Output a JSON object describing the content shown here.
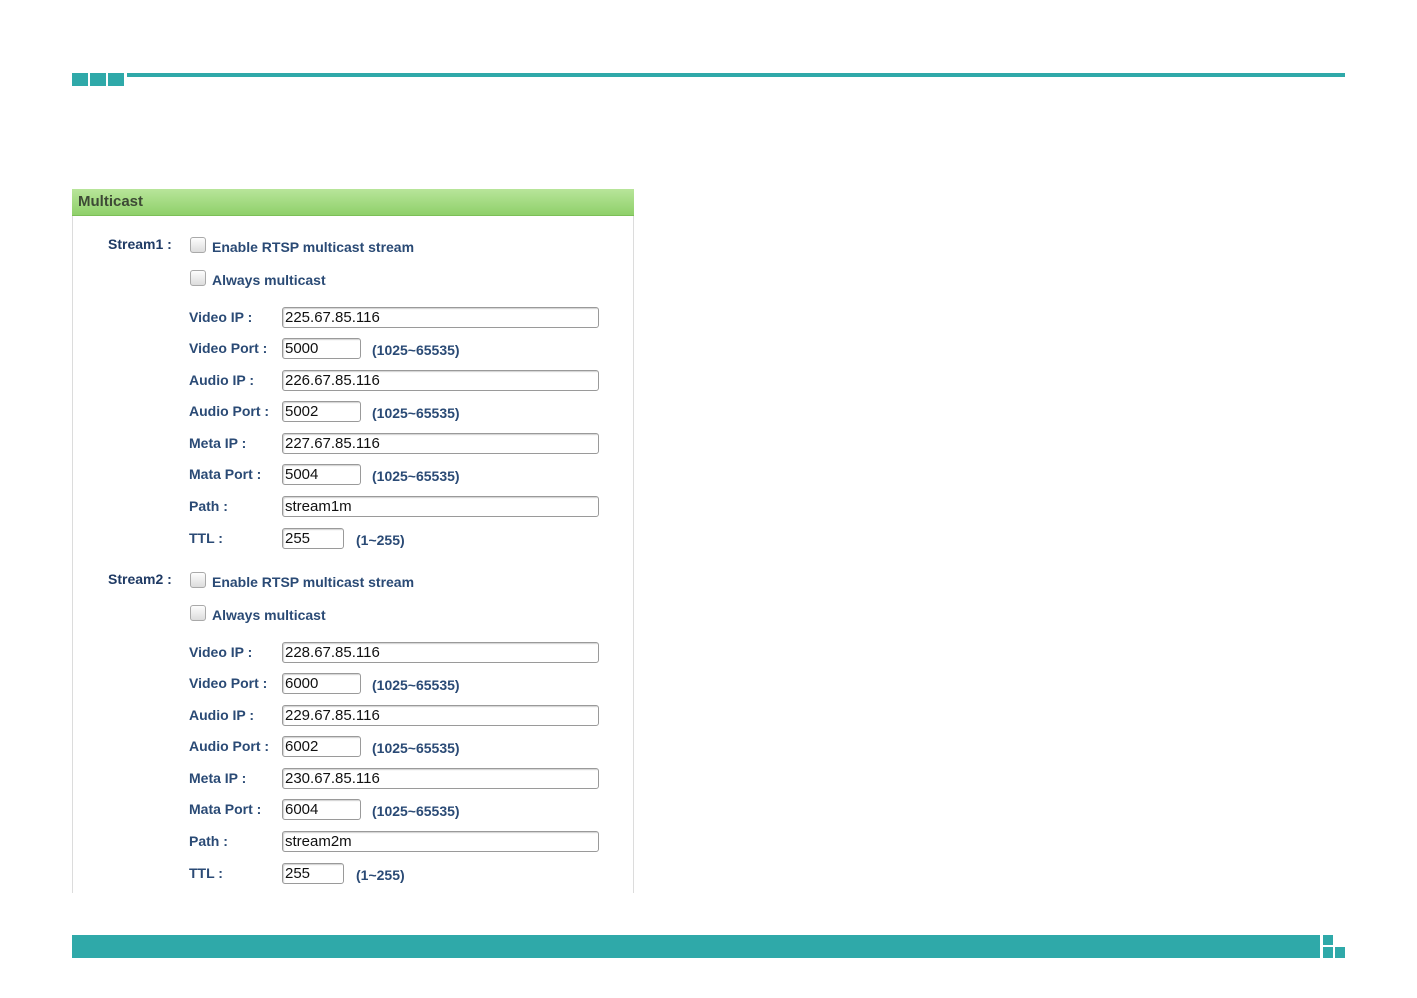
{
  "colors": {
    "accent": "#2fa9a9",
    "header_green": "#9ad877",
    "label_blue": "#2a4a75"
  },
  "panel": {
    "title": "Multicast"
  },
  "stream1": {
    "label": "Stream1 :",
    "enable_label": "Enable RTSP multicast stream",
    "always_label": "Always multicast",
    "video_ip_label": "Video IP :",
    "video_ip": "225.67.85.116",
    "video_port_label": "Video Port :",
    "video_port": "5000",
    "video_port_hint": "(1025~65535)",
    "audio_ip_label": "Audio IP :",
    "audio_ip": "226.67.85.116",
    "audio_port_label": "Audio Port :",
    "audio_port": "5002",
    "audio_port_hint": "(1025~65535)",
    "meta_ip_label": "Meta IP :",
    "meta_ip": "227.67.85.116",
    "meta_port_label": "Mata Port :",
    "meta_port": "5004",
    "meta_port_hint": "(1025~65535)",
    "path_label": "Path :",
    "path": "stream1m",
    "ttl_label": "TTL :",
    "ttl": "255",
    "ttl_hint": "(1~255)"
  },
  "stream2": {
    "label": "Stream2 :",
    "enable_label": "Enable RTSP multicast stream",
    "always_label": "Always multicast",
    "video_ip_label": "Video IP :",
    "video_ip": "228.67.85.116",
    "video_port_label": "Video Port :",
    "video_port": "6000",
    "video_port_hint": "(1025~65535)",
    "audio_ip_label": "Audio IP :",
    "audio_ip": "229.67.85.116",
    "audio_port_label": "Audio Port :",
    "audio_port": "6002",
    "audio_port_hint": "(1025~65535)",
    "meta_ip_label": "Meta IP :",
    "meta_ip": "230.67.85.116",
    "meta_port_label": "Mata Port :",
    "meta_port": "6004",
    "meta_port_hint": "(1025~65535)",
    "path_label": "Path :",
    "path": "stream2m",
    "ttl_label": "TTL :",
    "ttl": "255",
    "ttl_hint": "(1~255)"
  }
}
